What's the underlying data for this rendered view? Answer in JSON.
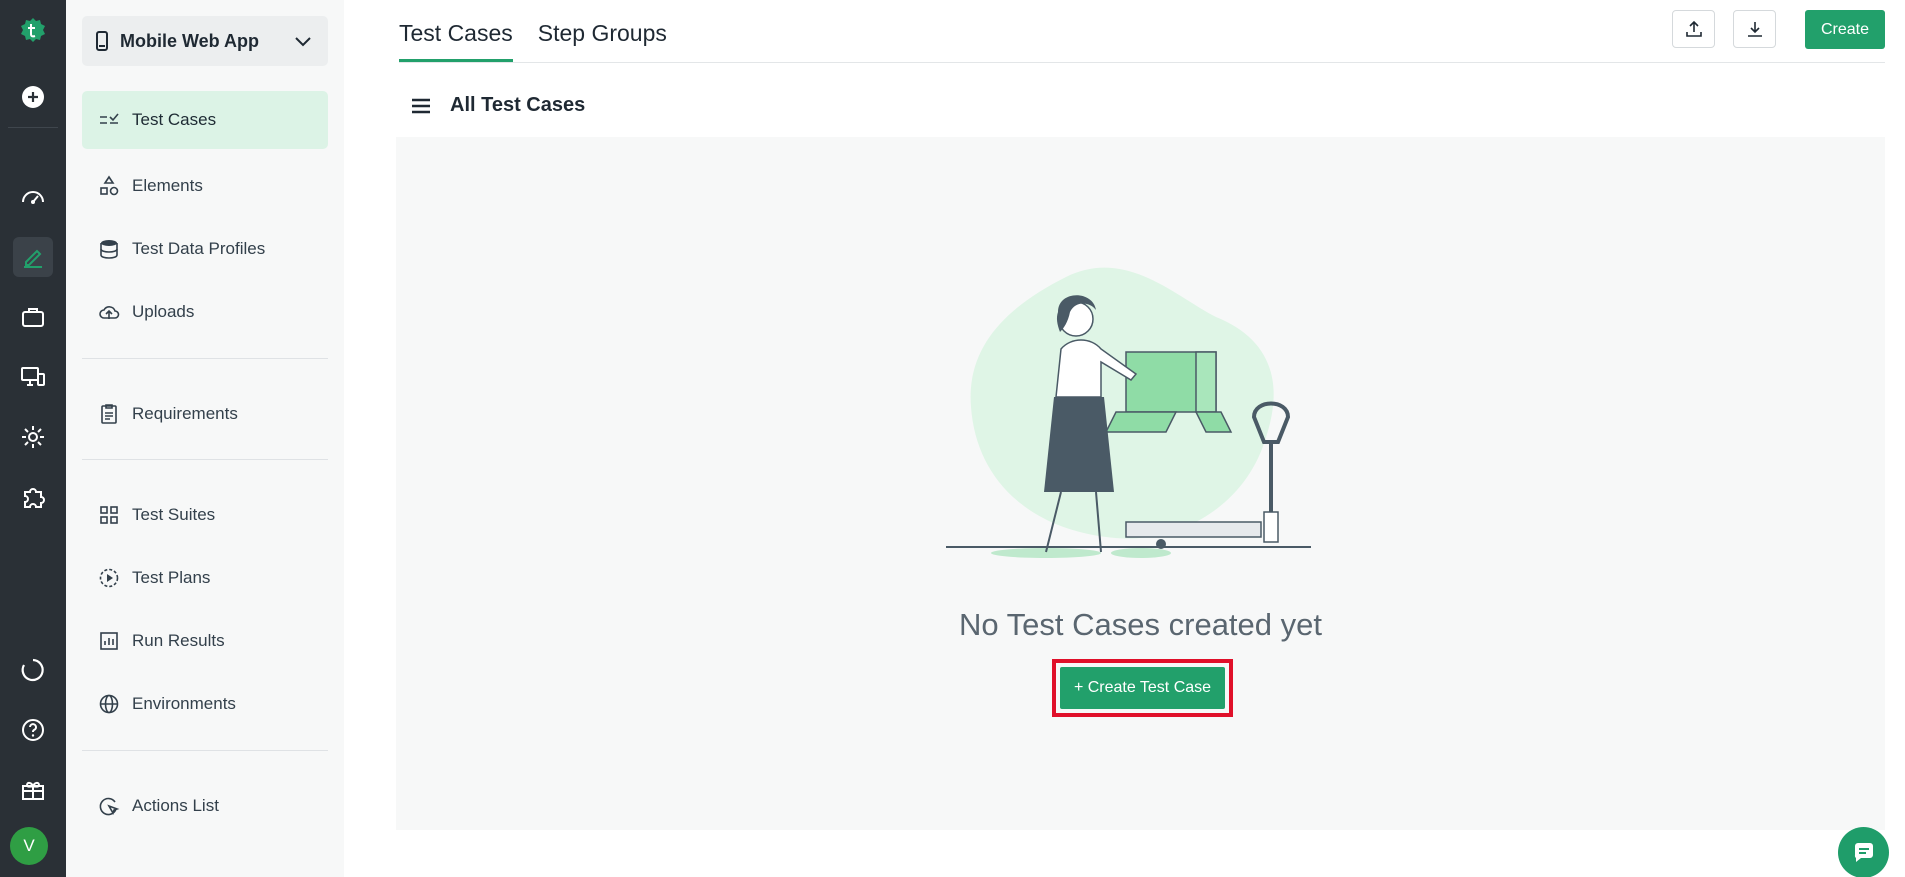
{
  "project": {
    "name": "Mobile Web App"
  },
  "sidebar": {
    "items": [
      {
        "label": "Test Cases"
      },
      {
        "label": "Elements"
      },
      {
        "label": "Test Data Profiles"
      },
      {
        "label": "Uploads"
      },
      {
        "label": "Requirements"
      },
      {
        "label": "Test Suites"
      },
      {
        "label": "Test Plans"
      },
      {
        "label": "Run Results"
      },
      {
        "label": "Environments"
      },
      {
        "label": "Actions List"
      }
    ]
  },
  "tabs": [
    {
      "label": "Test Cases"
    },
    {
      "label": "Step Groups"
    }
  ],
  "toolbar": {
    "create_label": "Create"
  },
  "list": {
    "title": "All Test Cases"
  },
  "empty": {
    "title": "No Test Cases created yet",
    "button_label": "+ Create Test Case"
  },
  "user": {
    "initial": "V"
  },
  "colors": {
    "accent": "#22a06b",
    "rail": "#2a3036",
    "highlight": "#e0102a"
  }
}
